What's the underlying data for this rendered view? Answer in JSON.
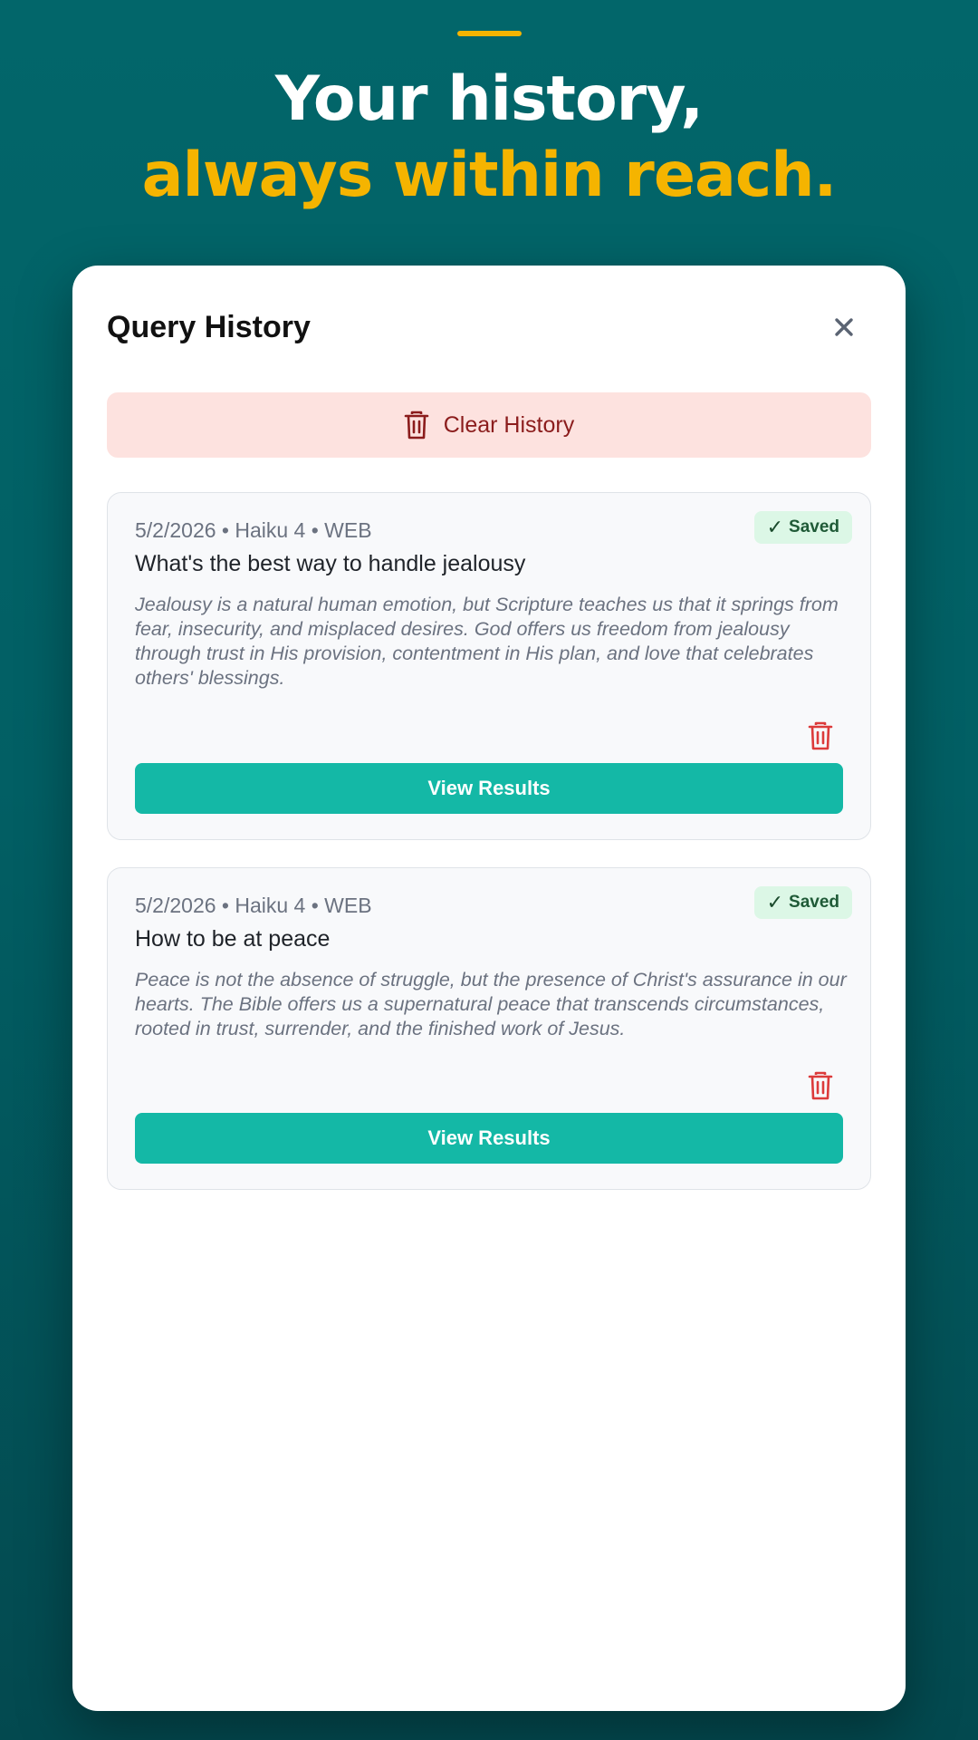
{
  "hero": {
    "line1": "Your history,",
    "line2": "always within reach."
  },
  "modal": {
    "title": "Query History",
    "close_icon": "close-icon",
    "clear_label": "Clear History"
  },
  "entries": [
    {
      "meta": "5/2/2026 • Haiku 4 • WEB",
      "badge": "Saved",
      "badge_check": "✓",
      "question": "What's the best way to handle jealousy",
      "summary": "Jealousy is a natural human emotion, but Scripture teaches us that it springs from fear, insecurity, and misplaced desires. God offers us freedom from jealousy through trust in His provision, contentment in His plan, and love that celebrates others' blessings.",
      "button": "View Results"
    },
    {
      "meta": "5/2/2026 • Haiku 4 • WEB",
      "badge": "Saved",
      "badge_check": "✓",
      "question": "How to be at peace",
      "summary": "Peace is not the absence of struggle, but the presence of Christ's assurance in our hearts. The Bible offers us a supernatural peace that transcends circumstances, rooted in trust, surrender, and the finished work of Jesus.",
      "button": "View Results"
    }
  ],
  "colors": {
    "background": "#02666a",
    "accent": "#f5b400",
    "teal_button": "#14b8a6",
    "danger": "#dc3b3b",
    "danger_bg": "#fde2df",
    "saved_bg": "#dcf7e6"
  }
}
